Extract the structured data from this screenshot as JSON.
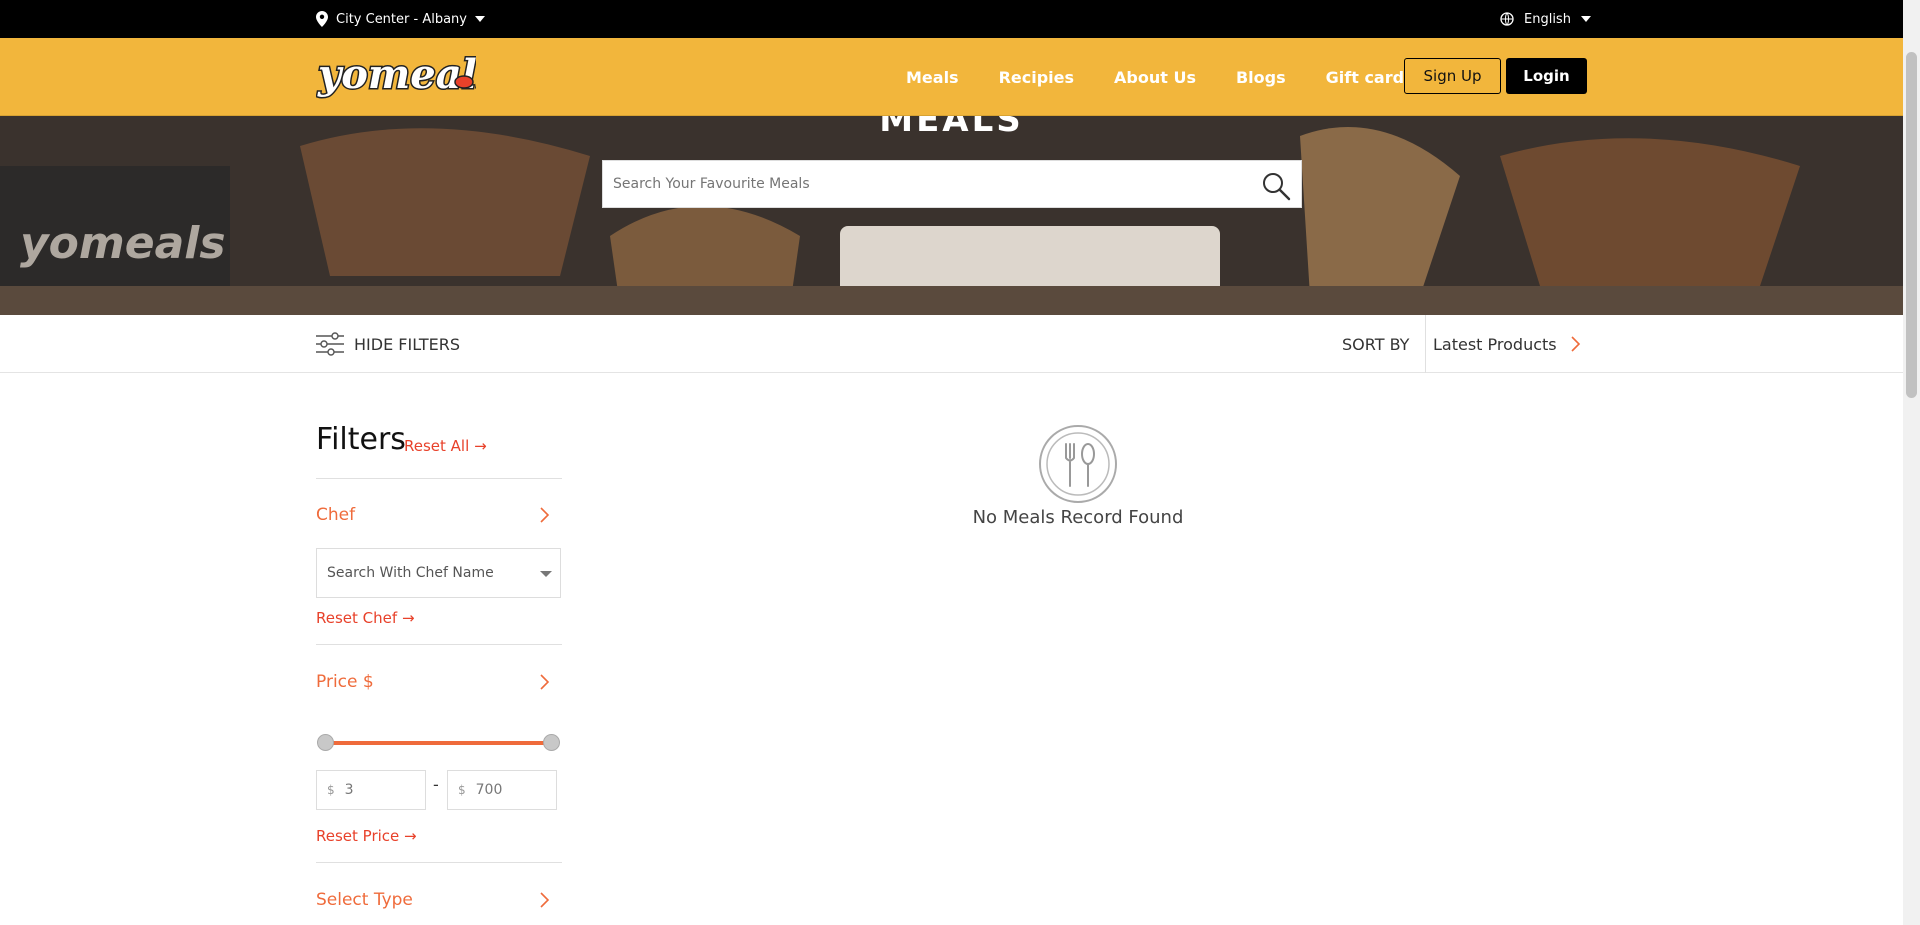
{
  "topbar": {
    "location": "City Center - Albany",
    "language": "English"
  },
  "header": {
    "logo_text": "yomeals",
    "nav": [
      "Meals",
      "Recipies",
      "About Us",
      "Blogs",
      "Gift card"
    ],
    "signup": "Sign Up",
    "login": "Login"
  },
  "hero": {
    "title": "MEALS",
    "search_placeholder": "Search Your Favourite Meals",
    "watermark": "yomeals"
  },
  "filterbar": {
    "hide_filters": "HIDE FILTERS",
    "sort_by": "SORT BY",
    "sort_value": "Latest Products"
  },
  "filters": {
    "title": "Filters",
    "reset_all": "Reset All",
    "chef": {
      "title": "Chef",
      "select_placeholder": "Search With Chef Name",
      "reset": "Reset Chef"
    },
    "price": {
      "title": "Price $",
      "currency": "$",
      "min": "3",
      "max": "700",
      "dash": "-",
      "reset": "Reset Price"
    },
    "type": {
      "title": "Select Type"
    }
  },
  "empty_state": {
    "message": "No Meals Record Found"
  },
  "colors": {
    "header_bg": "#f2b63c",
    "accent": "#ef6b3b",
    "link_red": "#e8412a"
  }
}
